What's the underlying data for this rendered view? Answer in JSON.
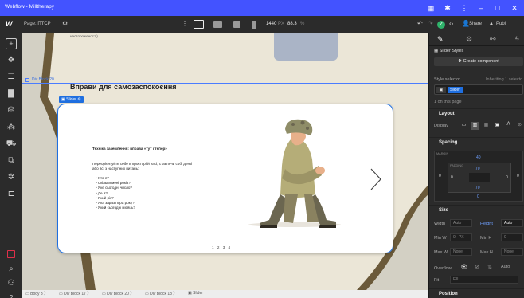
{
  "window": {
    "title": "Webflow - Milltherapy"
  },
  "appbar": {
    "page_label": "Page: ПТСР",
    "px_value": "1440",
    "px_unit": "PX",
    "zoom": "88.3",
    "zoom_unit": "%",
    "share_label": "Share",
    "publish_label": "Publi"
  },
  "canvas": {
    "top_text": "настороженості).",
    "div_block_label": "Div Block 20",
    "heading": "Вправи для самозаспокоєння",
    "slider_label": "Slider",
    "slide": {
      "title": "Техніка заземлення: вправа «тут і тепер»",
      "intro": "Переорієнтуйте себе в просторі й часі, ставлячи собі деякі або всі з наступних питань:",
      "questions": [
        "Хто я?",
        "Скільки мені років?",
        "Яке сьогодні число?",
        "Де я?",
        "Який рік?",
        "Яка зараз пора року?",
        "Який сьогодні місяць?"
      ]
    },
    "dots": [
      "1",
      "2",
      "3",
      "4"
    ]
  },
  "statusbar": {
    "crumbs": [
      "Body 3",
      "Div Block 17",
      "Div Block 20",
      "Div Block 18",
      "Slider"
    ]
  },
  "panel": {
    "styles_label": "Slider Styles",
    "create_component": "Create component",
    "style_selector": "Style selector",
    "inheriting": "Inheriting 1 selecto",
    "selector_tag": "Slider",
    "on_page": "1 on this page",
    "layout": "Layout",
    "display": "Display",
    "spacing": "Spacing",
    "margin_label": "MARGIN",
    "padding_label": "PADDING",
    "margin_top": "40",
    "margin_left": "0",
    "margin_right": "0",
    "margin_bottom": "0",
    "padding_top": "70",
    "padding_left": "0",
    "padding_right": "0",
    "padding_bottom": "70",
    "size": "Size",
    "width": "Width",
    "width_val": "Auto",
    "height": "Height",
    "height_val": "Auto",
    "min_w": "Min W",
    "min_w_val": "0",
    "min_w_unit": "PX",
    "min_h": "Min H",
    "min_h_val": "0",
    "max_w": "Max W",
    "max_w_val": "None",
    "max_h": "Max H",
    "max_h_val": "None",
    "overflow": "Overflow",
    "overflow_auto": "Auto",
    "fit": "Fit",
    "fit_val": "Fill",
    "position": "Position"
  },
  "colors": {
    "accent": "#4353ff",
    "canvas_bg": "#ebe6d7",
    "wave": "#6b5a3a",
    "select_blue": "#1f6fe0",
    "chrome": "#2b2b2b"
  }
}
